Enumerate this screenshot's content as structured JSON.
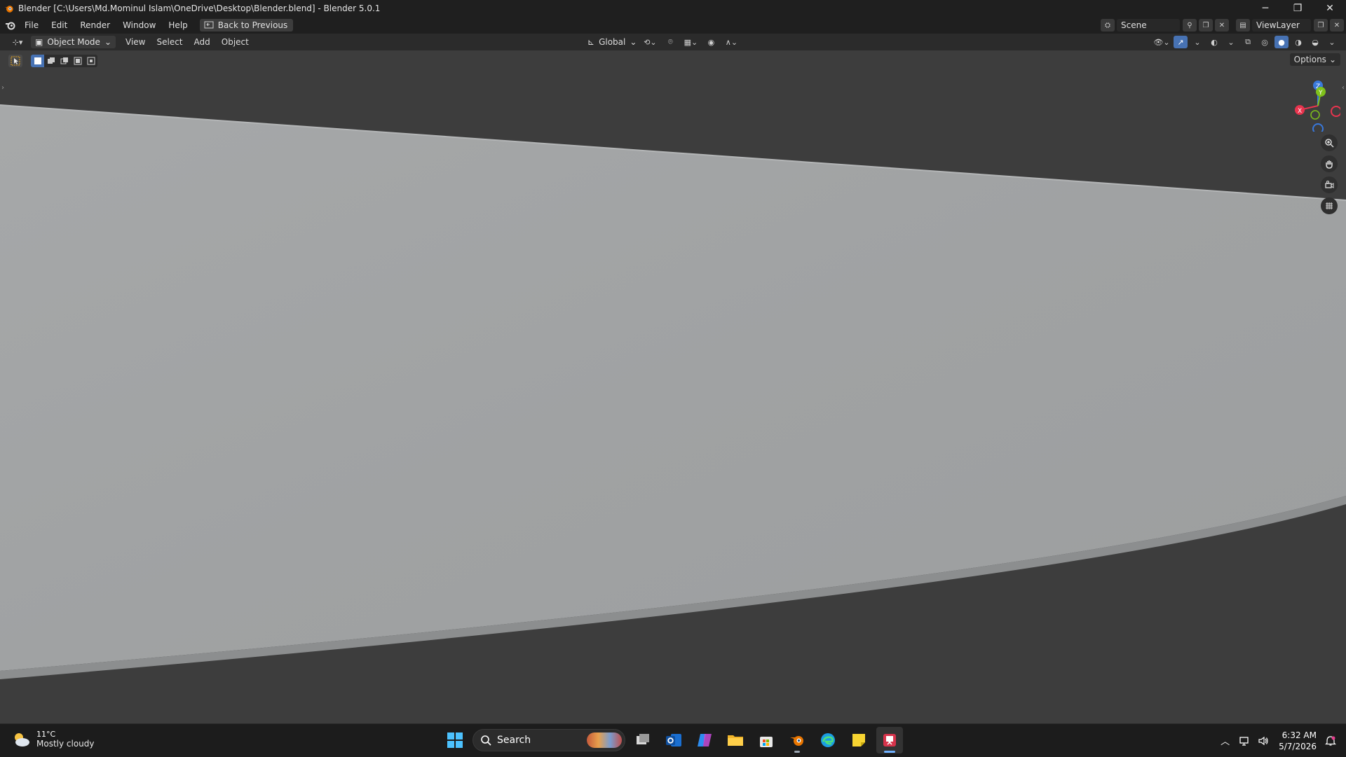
{
  "window": {
    "title": "Blender [C:\\Users\\Md.Mominul Islam\\OneDrive\\Desktop\\Blender.blend] - Blender 5.0.1",
    "controls": {
      "minimize": "─",
      "maximize": "❐",
      "close": "✕"
    }
  },
  "menubar": {
    "items": [
      "File",
      "Edit",
      "Render",
      "Window",
      "Help"
    ],
    "back_label": "Back to Previous",
    "scene": "Scene",
    "view_layer": "ViewLayer"
  },
  "header3d": {
    "mode": "Object Mode",
    "menus": [
      "View",
      "Select",
      "Add",
      "Object"
    ],
    "transform_orientation": "Global"
  },
  "viewport": {
    "options_label": "Options",
    "gizmo": {
      "x": "X",
      "y": "Y",
      "z": "Z"
    },
    "object_color": "#a3a6a8",
    "background_color": "#3d3d3d"
  },
  "taskbar": {
    "weather": {
      "temp": "11°C",
      "condition": "Mostly cloudy"
    },
    "search_label": "Search",
    "time": "6:32 AM",
    "date": "5/7/2026"
  },
  "colors": {
    "accent": "#4772b3",
    "axis_x": "#e8344e",
    "axis_y": "#7fc11b",
    "axis_z": "#3978db"
  }
}
